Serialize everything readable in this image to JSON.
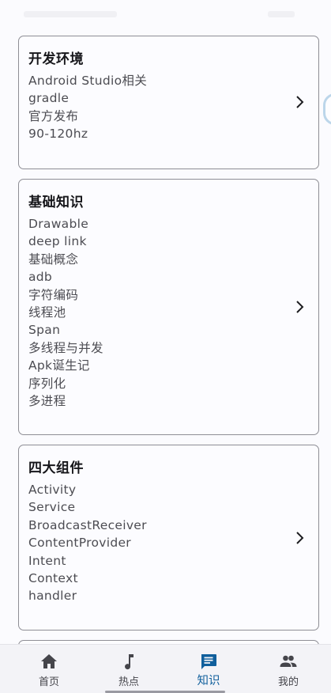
{
  "cards": [
    {
      "title": "开发环境",
      "items": [
        "Android Studio相关",
        "gradle",
        "官方发布",
        "90-120hz"
      ]
    },
    {
      "title": "基础知识",
      "items": [
        "Drawable",
        "deep link",
        "基础概念",
        "adb",
        "字符编码",
        "线程池",
        "Span",
        "多线程与并发",
        "Apk诞生记",
        "序列化",
        "多进程"
      ]
    },
    {
      "title": "四大组件",
      "items": [
        "Activity",
        "Service",
        "BroadcastReceiver",
        "ContentProvider",
        "Intent",
        "Context",
        "handler"
      ]
    }
  ],
  "bottom_nav": {
    "active_index": 2,
    "items": [
      {
        "label": "首页",
        "icon": "home-icon"
      },
      {
        "label": "热点",
        "icon": "music-note-icon"
      },
      {
        "label": "知识",
        "icon": "message-icon"
      },
      {
        "label": "我的",
        "icon": "people-icon"
      }
    ]
  },
  "colors": {
    "background": "#fbfbfe",
    "card_border": "#8e8e95",
    "accent": "#105f9c",
    "nav_background": "#f3f3f7",
    "text_secondary": "#4c4c52"
  }
}
